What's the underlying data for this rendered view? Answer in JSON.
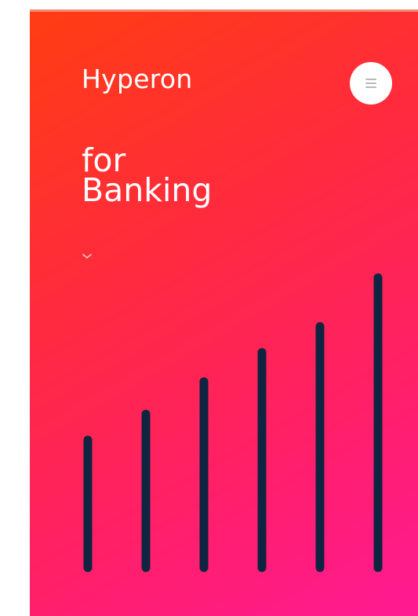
{
  "header": {
    "brand": "Hyperon",
    "menu_icon": "hamburger-menu-icon"
  },
  "hero": {
    "headline_line1": "for",
    "headline_line2": "Banking",
    "scroll_icon": "chevron-down-icon"
  },
  "colors": {
    "gradient_start": "#ff3d12",
    "gradient_end": "#ff1a93",
    "bar_color": "#0e2440",
    "text": "#ffffff"
  },
  "chart_data": {
    "type": "bar",
    "categories": [
      "",
      "",
      "",
      "",
      "",
      ""
    ],
    "values": [
      42,
      50,
      60,
      69,
      77,
      92
    ],
    "ylim": [
      0,
      100
    ],
    "grid": false
  }
}
